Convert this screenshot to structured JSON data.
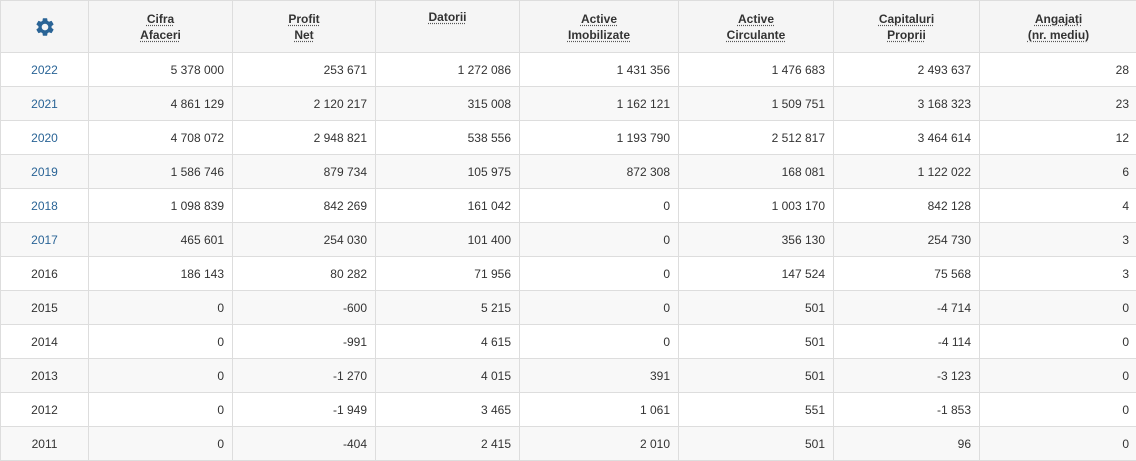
{
  "table": {
    "settings_icon": "gear-icon",
    "accent_color": "#2a6496",
    "headers": [
      {
        "line1": "Cifra",
        "line2": "Afaceri"
      },
      {
        "line1": "Profit",
        "line2": "Net"
      },
      {
        "line1": "Datorii",
        "line2": ""
      },
      {
        "line1": "Active",
        "line2": "Imobilizate"
      },
      {
        "line1": "Active",
        "line2": "Circulante"
      },
      {
        "line1": "Capitaluri",
        "line2": "Proprii"
      },
      {
        "line1": "Angajați",
        "line2": "(nr. mediu)"
      }
    ],
    "rows": [
      {
        "year": "2022",
        "linked": true,
        "values": [
          "5 378 000",
          "253 671",
          "1 272 086",
          "1 431 356",
          "1 476 683",
          "2 493 637",
          "28"
        ]
      },
      {
        "year": "2021",
        "linked": true,
        "values": [
          "4 861 129",
          "2 120 217",
          "315 008",
          "1 162 121",
          "1 509 751",
          "3 168 323",
          "23"
        ]
      },
      {
        "year": "2020",
        "linked": true,
        "values": [
          "4 708 072",
          "2 948 821",
          "538 556",
          "1 193 790",
          "2 512 817",
          "3 464 614",
          "12"
        ]
      },
      {
        "year": "2019",
        "linked": true,
        "values": [
          "1 586 746",
          "879 734",
          "105 975",
          "872 308",
          "168 081",
          "1 122 022",
          "6"
        ]
      },
      {
        "year": "2018",
        "linked": true,
        "values": [
          "1 098 839",
          "842 269",
          "161 042",
          "0",
          "1 003 170",
          "842 128",
          "4"
        ]
      },
      {
        "year": "2017",
        "linked": true,
        "values": [
          "465 601",
          "254 030",
          "101 400",
          "0",
          "356 130",
          "254 730",
          "3"
        ]
      },
      {
        "year": "2016",
        "linked": false,
        "values": [
          "186 143",
          "80 282",
          "71 956",
          "0",
          "147 524",
          "75 568",
          "3"
        ]
      },
      {
        "year": "2015",
        "linked": false,
        "values": [
          "0",
          "-600",
          "5 215",
          "0",
          "501",
          "-4 714",
          "0"
        ]
      },
      {
        "year": "2014",
        "linked": false,
        "values": [
          "0",
          "-991",
          "4 615",
          "0",
          "501",
          "-4 114",
          "0"
        ]
      },
      {
        "year": "2013",
        "linked": false,
        "values": [
          "0",
          "-1 270",
          "4 015",
          "391",
          "501",
          "-3 123",
          "0"
        ]
      },
      {
        "year": "2012",
        "linked": false,
        "values": [
          "0",
          "-1 949",
          "3 465",
          "1 061",
          "551",
          "-1 853",
          "0"
        ]
      },
      {
        "year": "2011",
        "linked": false,
        "values": [
          "0",
          "-404",
          "2 415",
          "2 010",
          "501",
          "96",
          "0"
        ]
      }
    ]
  }
}
